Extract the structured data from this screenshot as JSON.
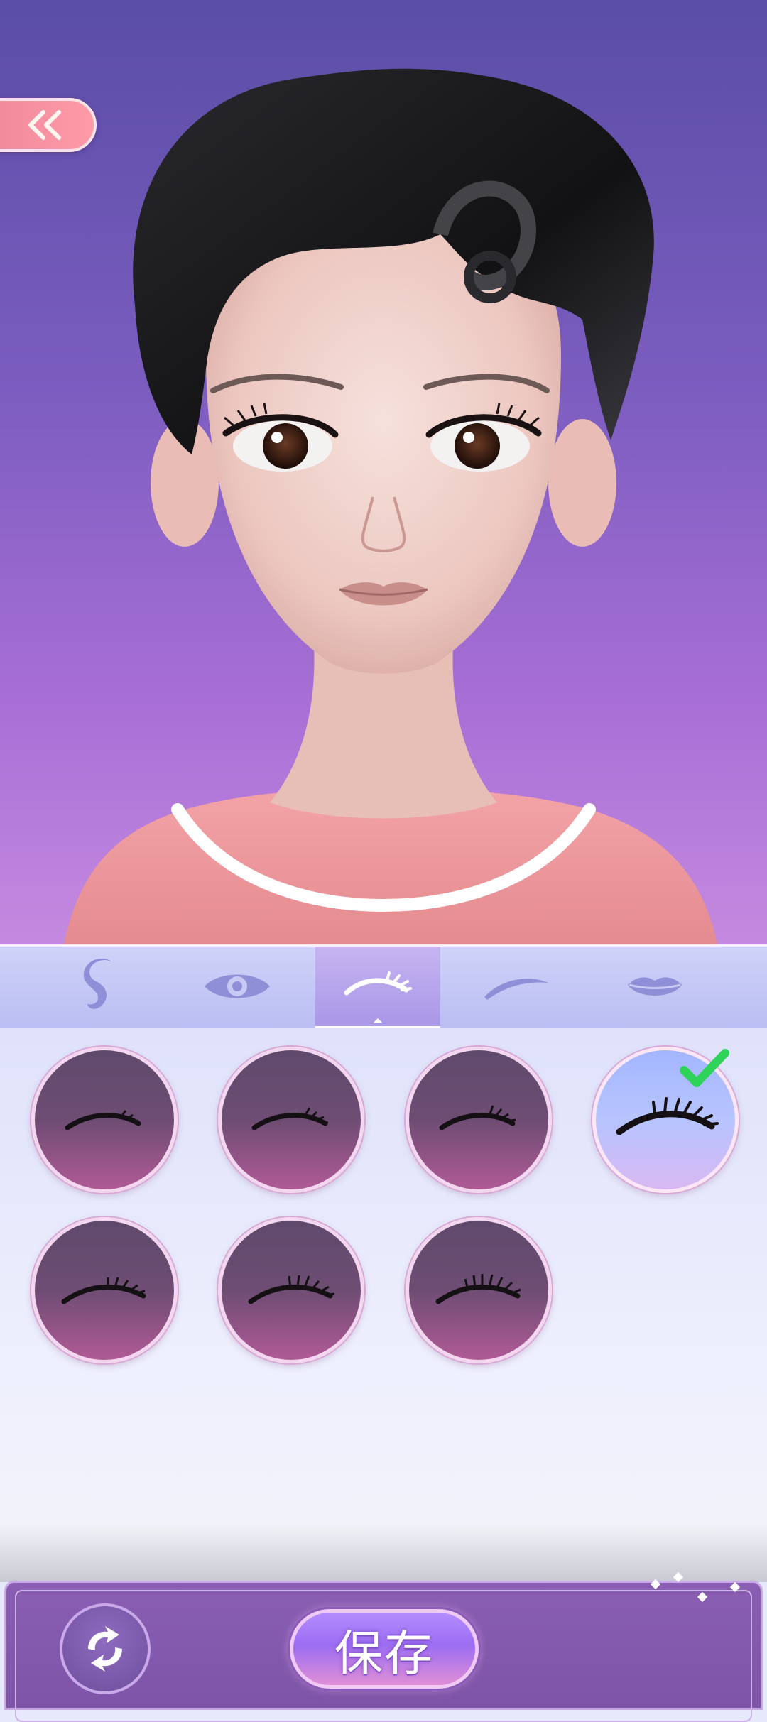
{
  "header": {
    "back_icon": "double-chevron-left-icon"
  },
  "tabs": [
    {
      "id": "hair",
      "icon": "hair-icon",
      "active": false
    },
    {
      "id": "eyes",
      "icon": "eye-icon",
      "active": false
    },
    {
      "id": "eyelashes",
      "icon": "eyelash-icon",
      "active": true
    },
    {
      "id": "eyebrows",
      "icon": "eyebrow-icon",
      "active": false
    },
    {
      "id": "lips",
      "icon": "lips-icon",
      "active": false
    }
  ],
  "options": [
    {
      "icon": "eyelash-style-1-icon",
      "selected": false
    },
    {
      "icon": "eyelash-style-2-icon",
      "selected": false
    },
    {
      "icon": "eyelash-style-3-icon",
      "selected": false
    },
    {
      "icon": "eyelash-style-4-icon",
      "selected": true
    },
    {
      "icon": "eyelash-style-5-icon",
      "selected": false
    },
    {
      "icon": "eyelash-style-6-icon",
      "selected": false
    },
    {
      "icon": "eyelash-style-7-icon",
      "selected": false
    }
  ],
  "bottom_bar": {
    "reset_icon": "refresh-icon",
    "save_label": "保存"
  },
  "colors": {
    "background_top": "#5a4ea6",
    "background_bottom": "#c48ae0",
    "accent_pink": "#ff9aa9",
    "check_green": "#2fd35a",
    "panel": "#dfe2fa"
  }
}
